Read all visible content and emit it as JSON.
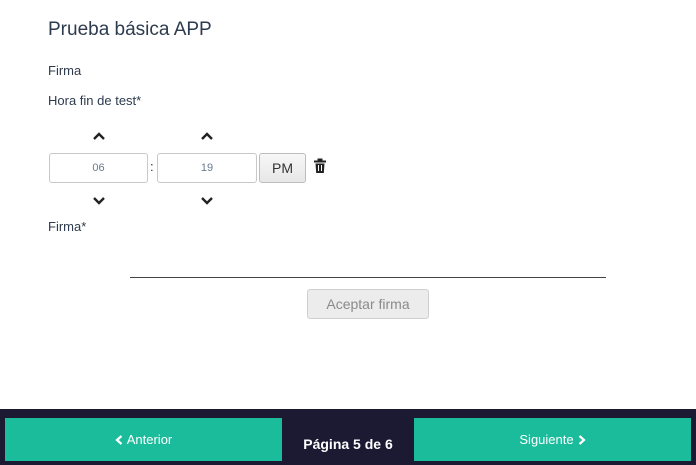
{
  "form": {
    "title": "Prueba básica APP",
    "section_label": "Firma",
    "end_time_label": "Hora fin de test*",
    "signature_label": "Firma*"
  },
  "time_picker": {
    "hours": "06",
    "minutes": "19",
    "meridian": "PM",
    "increment_icon": "chevron-up-icon",
    "decrement_icon": "chevron-down-icon",
    "clear_icon": "trash-icon",
    "separator": ":"
  },
  "signature": {
    "accept_label": "Aceptar firma"
  },
  "footer": {
    "prev_label": "Anterior",
    "next_label": "Siguiente",
    "page_text": "Página 5 de 6"
  },
  "colors": {
    "accent": "#1bbc9b",
    "footer_bg": "#1c1a33"
  }
}
